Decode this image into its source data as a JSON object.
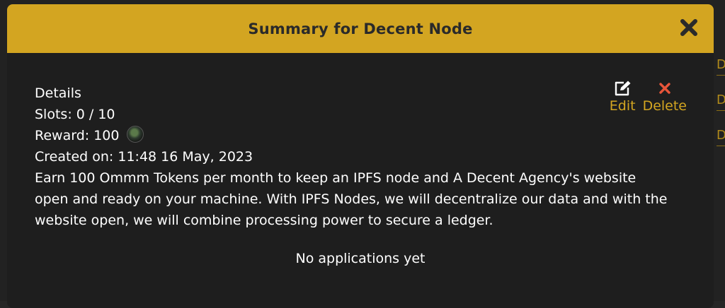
{
  "modal": {
    "title": "Summary for Decent Node",
    "details_heading": "Details",
    "slots_label": "Slots:",
    "slots_value": "0 / 10",
    "reward_label": "Reward:",
    "reward_value": "100",
    "created_label": "Created on:",
    "created_value": "11:48 16 May, 2023",
    "description": "Earn 100 Ommm Tokens per month to keep an IPFS node and A Decent Agency's website open and ready on your machine. With IPFS Nodes, we will decentralize our data and with the website open, we will combine processing power to secure a ledger.",
    "empty_state": "No applications yet"
  },
  "actions": {
    "edit_label": "Edit",
    "delete_label": "Delete"
  },
  "background": {
    "link_letter": "D"
  },
  "colors": {
    "header": "#d3a521",
    "body": "#1e1e1e",
    "accent": "#d3a521",
    "delete_icon": "#e8553a",
    "text": "#ffffff"
  },
  "icons": {
    "close": "close-icon",
    "edit": "edit-icon",
    "delete": "delete-icon",
    "token": "token-icon"
  }
}
